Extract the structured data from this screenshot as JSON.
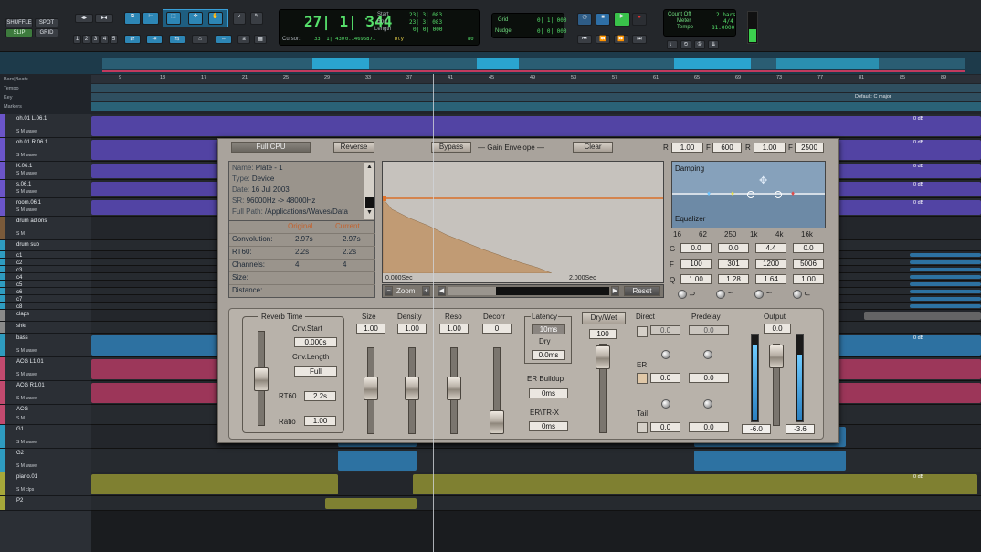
{
  "toolbar": {
    "shuffle": "SHUFFLE",
    "spot": "SPOT",
    "slip": "SLIP",
    "grid": "GRID",
    "zoom_presets": [
      "1",
      "2",
      "3",
      "4",
      "5"
    ],
    "main_counter": "27| 1| 344",
    "cursor_label": "Cursor:",
    "cursor_value": "33| 1| 430",
    "cursor_db": "0.14696871",
    "start_label": "Start",
    "end_label": "End",
    "length_label": "Length",
    "start_value": "23| 3| 083",
    "end_value": "23| 3| 083",
    "length_value": "0| 0| 000",
    "dly": "Dly",
    "bpm_small": "80",
    "grid_label": "Grid",
    "nudge_label": "Nudge",
    "grid_value": "0| 1| 000",
    "nudge_value": "0| 0| 000",
    "count_off": "Count Off",
    "meter_label": "Meter",
    "tempo_label": "Tempo",
    "bars": "2 bars",
    "meter_value": "4/4",
    "tempo_value": "81.0000"
  },
  "rulers": {
    "labels": [
      "Bars|Beats",
      "Tempo",
      "Key",
      "Markers"
    ],
    "ticks": [
      "9",
      "13",
      "17",
      "21",
      "25",
      "29",
      "33",
      "37",
      "41",
      "45",
      "49",
      "53",
      "57",
      "61",
      "65",
      "69",
      "73",
      "77",
      "81",
      "85",
      "89"
    ],
    "key_marker": "Default: C major"
  },
  "tracks": [
    {
      "name": "oh.01 L.06.1",
      "color": "#6b55c9",
      "mode": "wave",
      "db": "0 dB"
    },
    {
      "name": "oh.01 R.06.1",
      "color": "#6b55c9",
      "mode": "wave",
      "db": "0 dB"
    },
    {
      "name": "K.06.1",
      "color": "#6b55c9",
      "mode": "wave",
      "db": "0 dB"
    },
    {
      "name": "s.06.1",
      "color": "#6b55c9",
      "mode": "wave",
      "db": "0 dB"
    },
    {
      "name": "room.06.1",
      "color": "#6b55c9",
      "mode": "wave",
      "db": "0 dB"
    },
    {
      "name": "drum ad ons",
      "color": "#7a5a3a",
      "mode": "",
      "db": ""
    },
    {
      "name": "drum sub",
      "color": "#2e9bbf",
      "mode": "",
      "db": ""
    },
    {
      "name": "c1",
      "color": "#2e9bbf",
      "mode": "",
      "db": ""
    },
    {
      "name": "c2",
      "color": "#2e9bbf",
      "mode": "",
      "db": ""
    },
    {
      "name": "c3",
      "color": "#2e9bbf",
      "mode": "",
      "db": ""
    },
    {
      "name": "c4",
      "color": "#2e9bbf",
      "mode": "",
      "db": ""
    },
    {
      "name": "c5",
      "color": "#2e9bbf",
      "mode": "",
      "db": ""
    },
    {
      "name": "c6",
      "color": "#2e9bbf",
      "mode": "",
      "db": ""
    },
    {
      "name": "c7",
      "color": "#2e9bbf",
      "mode": "",
      "db": ""
    },
    {
      "name": "c8",
      "color": "#2e9bbf",
      "mode": "",
      "db": ""
    },
    {
      "name": "claps",
      "color": "#8a8a8a",
      "mode": "",
      "db": ""
    },
    {
      "name": "shkr",
      "color": "#8a8a8a",
      "mode": "",
      "db": ""
    },
    {
      "name": "bass",
      "color": "#2e9bbf",
      "mode": "wave",
      "db": "0 dB"
    },
    {
      "name": "ACG L1.01",
      "color": "#c24a6e",
      "mode": "wave",
      "db": ""
    },
    {
      "name": "ACG R1.01",
      "color": "#c24a6e",
      "mode": "wave",
      "db": ""
    },
    {
      "name": "ACG",
      "color": "#c24a6e",
      "mode": "",
      "db": ""
    },
    {
      "name": "G1",
      "color": "#2e9bbf",
      "mode": "wave",
      "db": ""
    },
    {
      "name": "G2",
      "color": "#2e9bbf",
      "mode": "wave",
      "db": ""
    },
    {
      "name": "piano.01",
      "color": "#a6a83a",
      "mode": "clps",
      "db": "0 dB"
    },
    {
      "name": "P2",
      "color": "#a6a83a",
      "mode": "",
      "db": ""
    }
  ],
  "plugin": {
    "full_cpu": "Full CPU",
    "reverse": "Reverse",
    "bypass": "Bypass",
    "gain_envelope": "Gain Envelope",
    "clear": "Clear",
    "r1_label": "R",
    "r1_value": "1.00",
    "f_label": "F",
    "f_value": "600",
    "r2_label": "R",
    "r2_value": "1.00",
    "f2_label": "F",
    "f2_value": "2500",
    "info": {
      "name_k": "Name:",
      "name_v": "Plate - 1",
      "type_k": "Type:",
      "type_v": "Device",
      "date_k": "Date:",
      "date_v": "16 Jul 2003",
      "sr_k": "SR:",
      "sr_v": "96000Hz -> 48000Hz",
      "path_k": "Full Path:",
      "path_v": "/Applications/Waves/Data"
    },
    "table_header_original": "Original",
    "table_header_current": "Current",
    "table_rows": [
      {
        "k": "Convolution:",
        "o": "2.97s",
        "c": "2.97s"
      },
      {
        "k": "RT60:",
        "o": "2.2s",
        "c": "2.2s"
      },
      {
        "k": "Channels:",
        "o": "4",
        "c": "4"
      },
      {
        "k": "Size:",
        "o": "",
        "c": ""
      },
      {
        "k": "Distance:",
        "o": "",
        "c": ""
      }
    ],
    "graph_start": "0.000Sec",
    "graph_end": "2.000Sec",
    "zoom_label": "Zoom",
    "reset": "Reset",
    "damping": "Damping",
    "equalizer": "Equalizer",
    "eq_freqs": [
      "16",
      "62",
      "250",
      "1k",
      "4k",
      "16k"
    ],
    "eq_g_label": "G",
    "eq_f_label": "F",
    "eq_q_label": "Q",
    "eq_g": [
      "0.0",
      "0.0",
      "4.4",
      "0.0"
    ],
    "eq_f": [
      "100",
      "301",
      "1200",
      "5006"
    ],
    "eq_q": [
      "1.00",
      "1.28",
      "1.64",
      "1.00"
    ],
    "reverb_time": "Reverb Time",
    "cnv_start": "Cnv.Start",
    "cnv_start_value": "0.000s",
    "cnv_length": "Cnv.Length",
    "cnv_length_value": "Full",
    "rt60": "RT60",
    "rt60_value": "2.2s",
    "ratio": "Ratio",
    "ratio_value": "1.00",
    "size": "Size",
    "size_value": "1.00",
    "density": "Density",
    "density_value": "1.00",
    "reso": "Reso",
    "reso_value": "1.00",
    "decorr": "Decorr",
    "decorr_value": "0",
    "latency": "Latency",
    "latency_value": "10ms",
    "dry": "Dry",
    "dry_value": "0.0ms",
    "er_buildup": "ER Buildup",
    "er_buildup_value": "0ms",
    "ertr_x": "ER\\TR-X",
    "ertr_x_value": "0ms",
    "dry_wet": "Dry/Wet",
    "dry_wet_value": "100",
    "direct": "Direct",
    "direct_value": "0.0",
    "predelay": "Predelay",
    "predelay_value": "0.0",
    "er": "ER",
    "er_value": "0.0",
    "er_predelay": "0.0",
    "tail": "Tail",
    "tail_value": "0.0",
    "tail_predelay": "0.0",
    "output": "Output",
    "output_value": "0.0",
    "out_l": "-6.0",
    "out_r": "-3.6"
  },
  "colors": {
    "purple_clip": "#5a49b8",
    "blue_clip": "#2f7fb6",
    "pink_clip": "#b23a62",
    "olive_clip": "#8f9133"
  }
}
